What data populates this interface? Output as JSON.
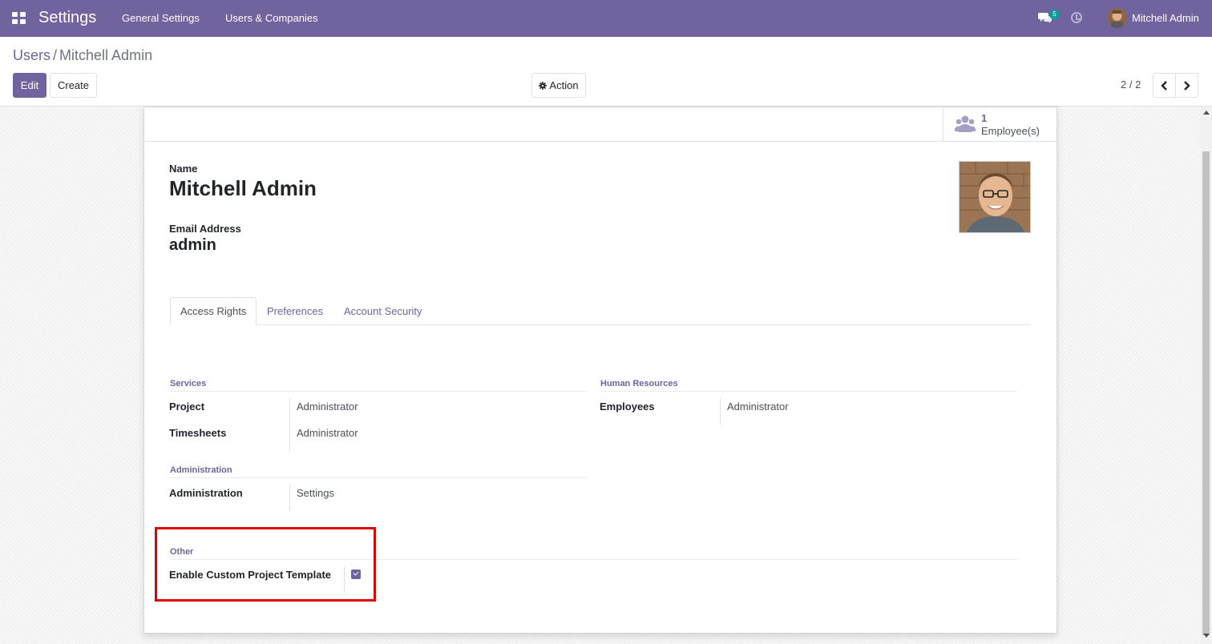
{
  "navbar": {
    "app_name": "Settings",
    "menu": [
      "General Settings",
      "Users & Companies"
    ],
    "chat_count": "5",
    "user_name": "Mitchell Admin",
    "color": "#71639e"
  },
  "breadcrumb": {
    "parent": "Users",
    "separator": "/",
    "current": "Mitchell Admin"
  },
  "toolbar": {
    "edit_label": "Edit",
    "create_label": "Create",
    "action_label": "Action"
  },
  "pager": {
    "value": "2 / 2"
  },
  "stat_button": {
    "value": "1",
    "label": "Employee(s)"
  },
  "form": {
    "name_label": "Name",
    "name_value": "Mitchell Admin",
    "email_label": "Email Address",
    "email_value": "admin"
  },
  "tabs": [
    {
      "label": "Access Rights",
      "active": true
    },
    {
      "label": "Preferences",
      "active": false
    },
    {
      "label": "Account Security",
      "active": false
    }
  ],
  "groups": {
    "services": {
      "title": "Services",
      "fields": [
        {
          "label": "Project",
          "value": "Administrator"
        },
        {
          "label": "Timesheets",
          "value": "Administrator"
        }
      ]
    },
    "human_resources": {
      "title": "Human Resources",
      "fields": [
        {
          "label": "Employees",
          "value": "Administrator"
        }
      ]
    },
    "administration": {
      "title": "Administration",
      "fields": [
        {
          "label": "Administration",
          "value": "Settings"
        }
      ]
    },
    "other": {
      "title": "Other",
      "fields": [
        {
          "label": "Enable Custom Project Template",
          "checked": true
        }
      ]
    }
  },
  "icons": {
    "apps": "apps-grid-icon",
    "chat": "chat-icon",
    "activity": "clock-icon",
    "action": "gear-icon",
    "prev": "chevron-left-icon",
    "next": "chevron-right-icon",
    "employees": "users-icon"
  },
  "highlight_color": "#e00000"
}
